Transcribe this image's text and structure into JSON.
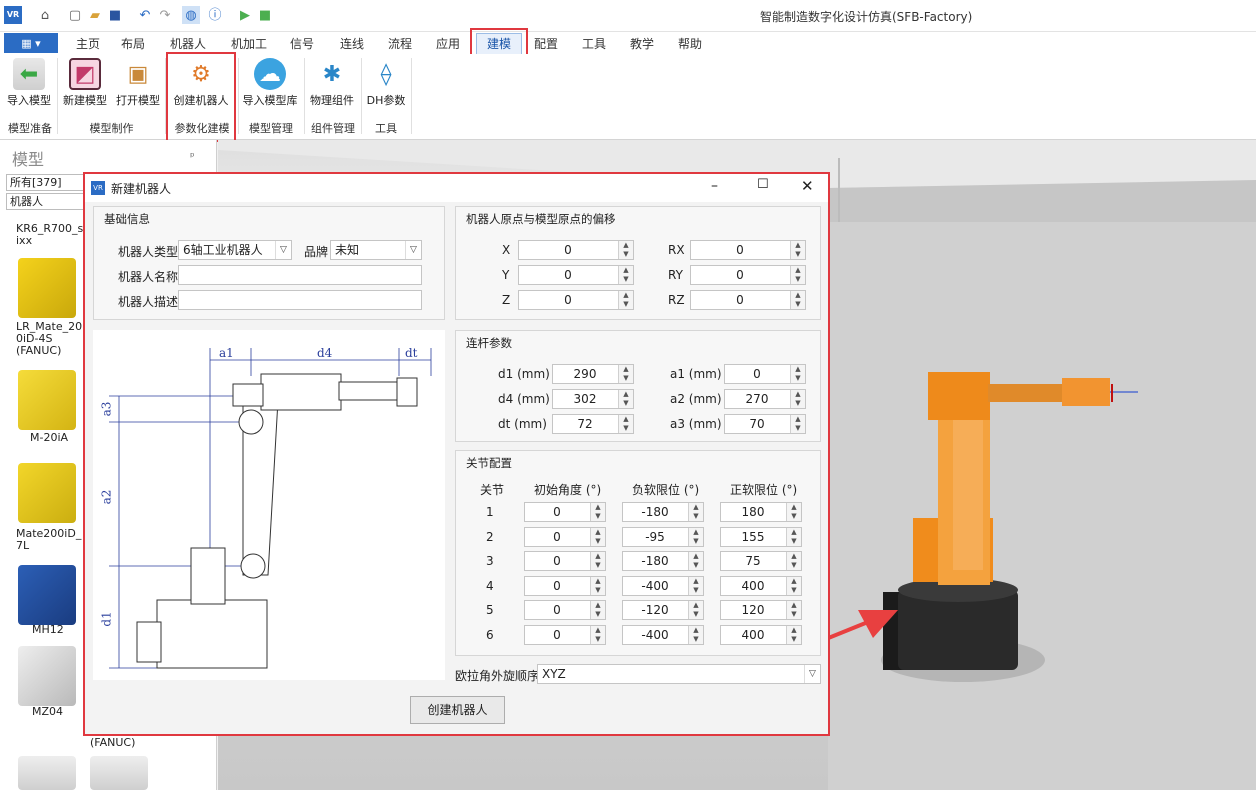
{
  "app": {
    "title": "智能制造数字化设计仿真(SFB-Factory)",
    "logo": "VR",
    "file_label": "▦"
  },
  "menu": {
    "tabs": [
      "主页",
      "布局",
      "机器人",
      "机加工",
      "信号",
      "连线",
      "流程",
      "应用",
      "建模",
      "配置",
      "工具",
      "教学",
      "帮助"
    ],
    "active": "建模"
  },
  "ribbon": {
    "buttons": [
      "导入模型",
      "新建模型",
      "打开模型",
      "创建机器人",
      "导入模型库",
      "物理组件",
      "DH参数"
    ],
    "groups": [
      "模型准备",
      "模型制作",
      "参数化建模",
      "模型管理",
      "组件管理",
      "工具"
    ]
  },
  "left_panel": {
    "title": "模型",
    "filter": "所有[379]",
    "category": "机器人",
    "items": [
      "KR6_R700_s ixx",
      "LR_Mate_20 0iD-4S (FANUC)",
      "M-20iA",
      "Mate200iD_ 7L",
      "MH12",
      "MZ04",
      "(FANUC)"
    ]
  },
  "dialog": {
    "title": "新建机器人",
    "basic": {
      "title": "基础信息",
      "type_label": "机器人类型",
      "type_value": "6轴工业机器人",
      "brand_label": "品牌",
      "brand_value": "未知",
      "name_label": "机器人名称",
      "name_value": "",
      "desc_label": "机器人描述",
      "desc_value": ""
    },
    "offset": {
      "title": "机器人原点与模型原点的偏移",
      "fields": [
        {
          "label": "X",
          "value": "0"
        },
        {
          "label": "RX",
          "value": "0"
        },
        {
          "label": "Y",
          "value": "0"
        },
        {
          "label": "RY",
          "value": "0"
        },
        {
          "label": "Z",
          "value": "0"
        },
        {
          "label": "RZ",
          "value": "0"
        }
      ]
    },
    "link": {
      "title": "连杆参数",
      "fields": [
        {
          "label": "d1 (mm)",
          "value": "290"
        },
        {
          "label": "a1 (mm)",
          "value": "0"
        },
        {
          "label": "d4 (mm)",
          "value": "302"
        },
        {
          "label": "a2 (mm)",
          "value": "270"
        },
        {
          "label": "dt (mm)",
          "value": "72"
        },
        {
          "label": "a3 (mm)",
          "value": "70"
        }
      ]
    },
    "joints": {
      "title": "关节配置",
      "headers": [
        "关节",
        "初始角度 (°)",
        "负软限位 (°)",
        "正软限位 (°)"
      ],
      "rows": [
        [
          "1",
          "0",
          "-180",
          "180"
        ],
        [
          "2",
          "0",
          "-95",
          "155"
        ],
        [
          "3",
          "0",
          "-180",
          "75"
        ],
        [
          "4",
          "0",
          "-400",
          "400"
        ],
        [
          "5",
          "0",
          "-120",
          "120"
        ],
        [
          "6",
          "0",
          "-400",
          "400"
        ]
      ]
    },
    "euler": {
      "label": "欧拉角外旋顺序",
      "value": "XYZ"
    },
    "diagram_labels": [
      "a1",
      "d4",
      "dt",
      "a3",
      "a2",
      "d1"
    ],
    "create_button": "创建机器人"
  },
  "colors": {
    "accent": "#2b6cc4",
    "highlight": "#e0383f",
    "robot": "#f08c1c"
  }
}
